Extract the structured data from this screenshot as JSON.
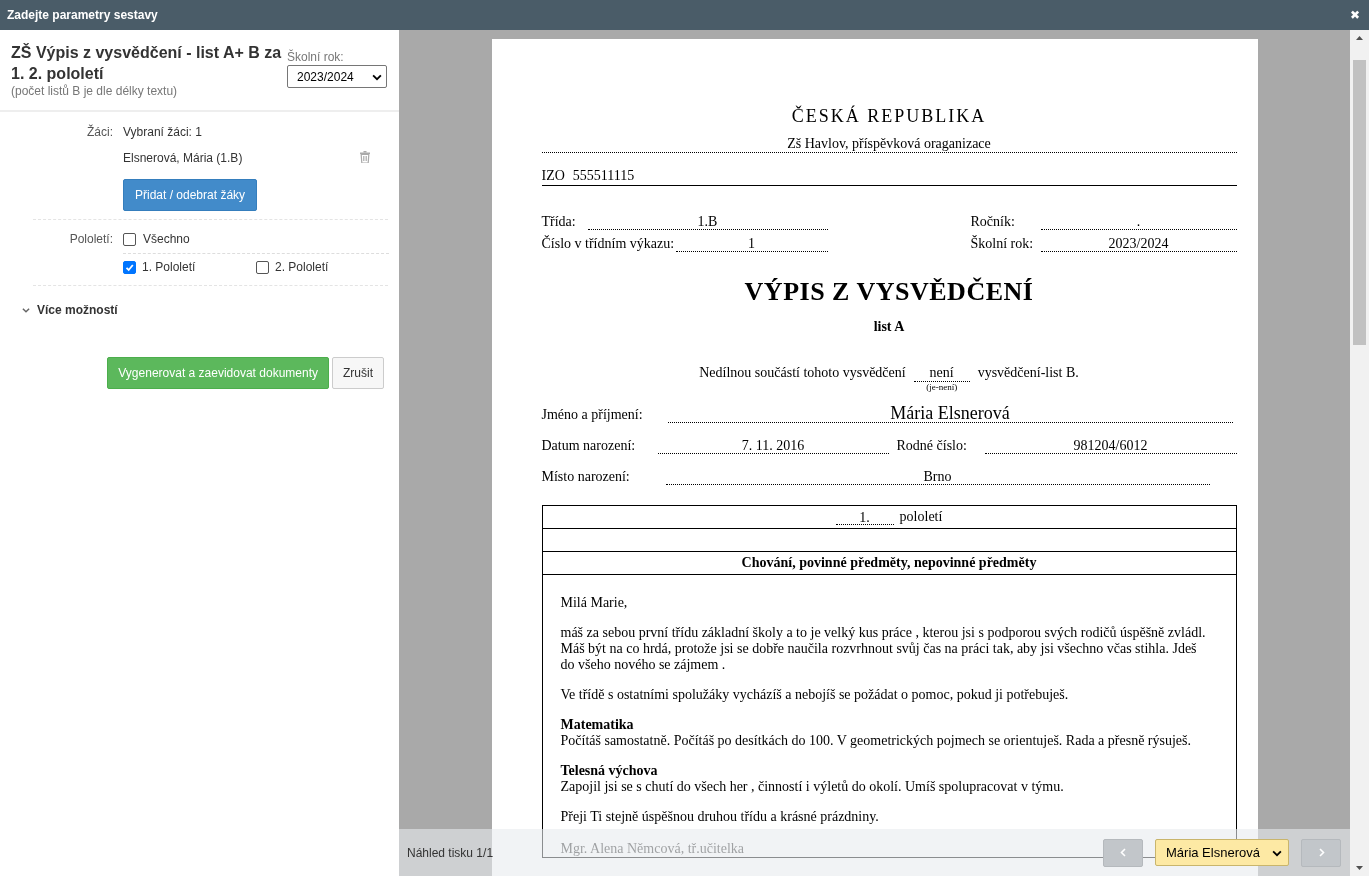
{
  "window": {
    "title": "Zadejte parametry sestavy",
    "close": "✖"
  },
  "form": {
    "title": "ZŠ Výpis z vysvědčení - list A+ B za 1. 2. pololetí",
    "subtitle": "(počet listů B je dle délky textu)",
    "year_label": "Školní rok:",
    "year_value": "2023/2024",
    "students_label": "Žáci:",
    "students_count": "Vybraní žáci: 1",
    "students": [
      {
        "name": "Elsnerová, Mária (1.B)"
      }
    ],
    "add_button": "Přidat / odebrat žáky",
    "term_label": "Pololetí:",
    "term_all": {
      "label": "Všechno",
      "checked": false
    },
    "terms": [
      {
        "label": "1. Pololetí",
        "checked": true
      },
      {
        "label": "2. Pololetí",
        "checked": false
      }
    ],
    "more_options": {
      "label": "Více možností",
      "expanded": false
    },
    "buttons": [
      {
        "label": "Vygenerovat a zaevidovat dokumenty",
        "kind": "primary"
      },
      {
        "label": "Zrušit",
        "kind": "default"
      }
    ]
  },
  "document": {
    "country": "ČESKÁ REPUBLIKA",
    "school": "Zš Havlov, příspěvková oraganizace",
    "izo_label": "IZO",
    "izo": "555511115",
    "class_label": "Třída:",
    "class_value": "1.B",
    "grade_label": "Ročník:",
    "grade_value": ".",
    "register_label": "Číslo v třídním výkazu:",
    "register_value": "1",
    "year_label": "Školní rok:",
    "year_value": "2023/2024",
    "heading": "VÝPIS Z VYSVĚDČENÍ",
    "sheet": "list A",
    "note_before": "Nedílnou součástí tohoto vysvědčení",
    "note_value": "není",
    "note_hint": "(je-není)",
    "note_after": "vysvědčení-list B.",
    "name_label": "Jméno a příjmení:",
    "name_value": "Mária Elsnerová",
    "birth_label": "Datum narození:",
    "birth_value": "7. 11. 2016",
    "id_label": "Rodné číslo:",
    "id_value": "981204/6012",
    "place_label": "Místo narození:",
    "place_value": "Brno",
    "term_value": "1.",
    "term_label": "pololetí",
    "section_heading": "Chování, povinné předměty, nepovinné předměty",
    "blocks": [
      {
        "text": "Milá Marie,"
      },
      {
        "text": "máš za sebou první třídu základní školy a to je velký kus práce , kterou jsi s podporou svých rodičů úspěšně zvládl. Máš být na co hrdá, protože  jsi se  dobře naučila rozvrhnout svůj čas na práci tak, aby jsi všechno včas stihla. Jdeš do všeho nového se zájmem ."
      },
      {
        "text": "Ve třídě s ostatními spolužáky vycházíš  a nebojíš se požádat o pomoc, pokud ji potřebuješ."
      },
      {
        "heading": "Matematika",
        "text": "Počítáš samostatně. Počítáš po desítkách do 100. V geometrických pojmech se orientuješ. Rada a přesně rýsuješ."
      },
      {
        "heading": "Telesná výchova",
        "text": "Zapojil jsi se s chutí do všech her , činností i výletů do okolí. Umíš spolupracovat v týmu."
      },
      {
        "text": "Přeji Ti stejně úspěšnou druhou třídu a krásné prázdniny."
      }
    ],
    "signature": "Mgr. Alena Němcová, tř.učitelka"
  },
  "preview_bar": {
    "label": "Náhled tisku 1/1",
    "student": "Mária Elsnerová"
  }
}
